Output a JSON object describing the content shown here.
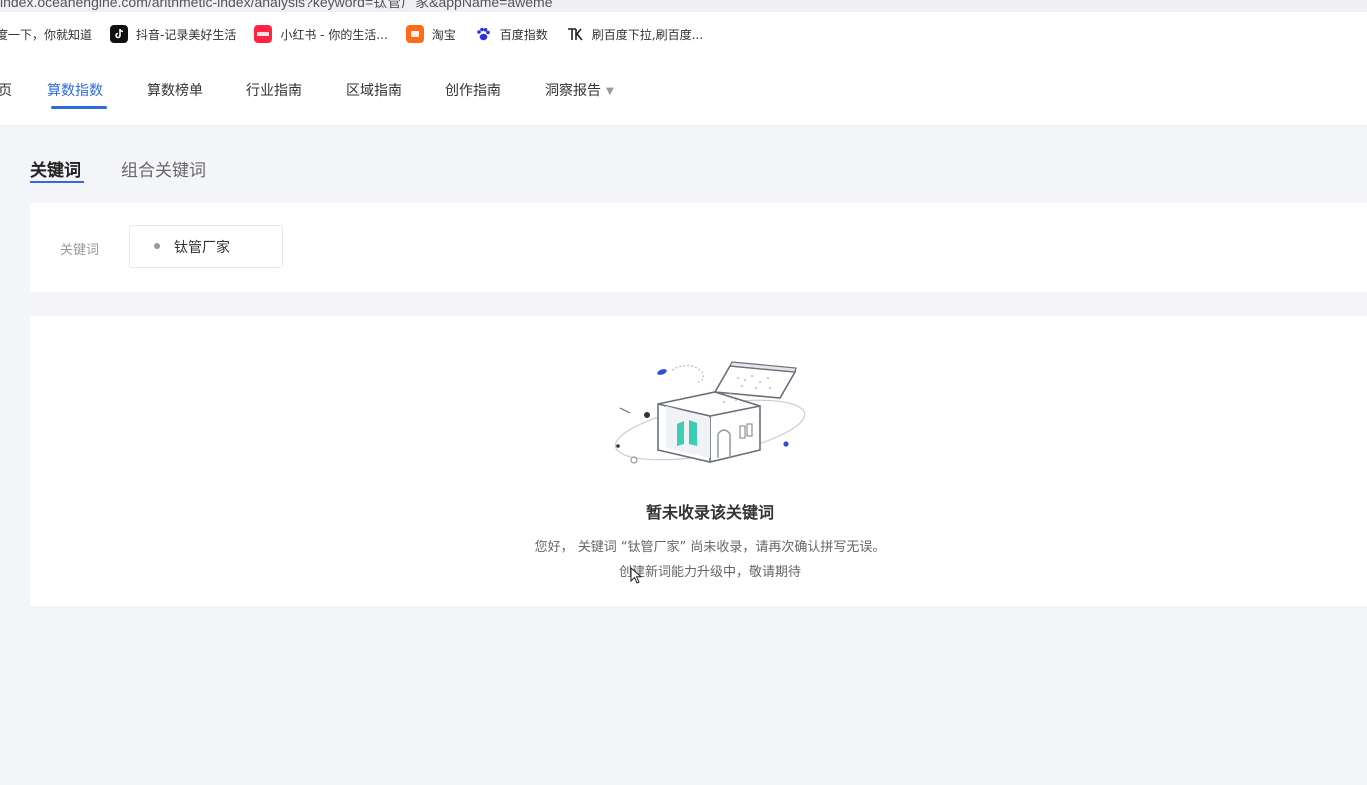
{
  "address_bar": {
    "url": "index.oceanengine.com/arithmetic-index/analysis?keyword=钛管厂家&appName=aweme"
  },
  "bookmarks": [
    {
      "label": "度一下，你就知道",
      "icon": "baidu-icon",
      "color": "#ffffff"
    },
    {
      "label": "抖音-记录美好生活",
      "icon": "douyin-icon",
      "color": "#111111"
    },
    {
      "label": "小红书 - 你的生活...",
      "icon": "xiaohongshu-icon",
      "color": "#ff2442"
    },
    {
      "label": "淘宝",
      "icon": "taobao-icon",
      "color": "#ff6a1a"
    },
    {
      "label": "百度指数",
      "icon": "baidu-paw-icon",
      "color": "#2932e1"
    },
    {
      "label": "刷百度下拉,刷百度...",
      "icon": "tk-icon",
      "color": "#ffffff"
    }
  ],
  "topnav": {
    "items": [
      {
        "label": "页",
        "active": false
      },
      {
        "label": "算数指数",
        "active": true
      },
      {
        "label": "算数榜单",
        "active": false
      },
      {
        "label": "行业指南",
        "active": false
      },
      {
        "label": "区域指南",
        "active": false
      },
      {
        "label": "创作指南",
        "active": false
      },
      {
        "label": "洞察报告",
        "active": false,
        "dropdown": true
      }
    ],
    "accent_color": "#2f6bdc"
  },
  "subtabs": [
    {
      "label": "关键词",
      "active": true
    },
    {
      "label": "组合关键词",
      "active": false
    }
  ],
  "keyword_filter": {
    "label": "关键词",
    "chip": "钛管厂家"
  },
  "empty_state": {
    "title": "暂未收录该关键词",
    "description": "您好， 关键词 “钛管厂家” 尚未收录，请再次确认拼写无误。",
    "description2": "创建新词能力升级中，敬请期待",
    "illustration": "empty-box-illustration"
  }
}
